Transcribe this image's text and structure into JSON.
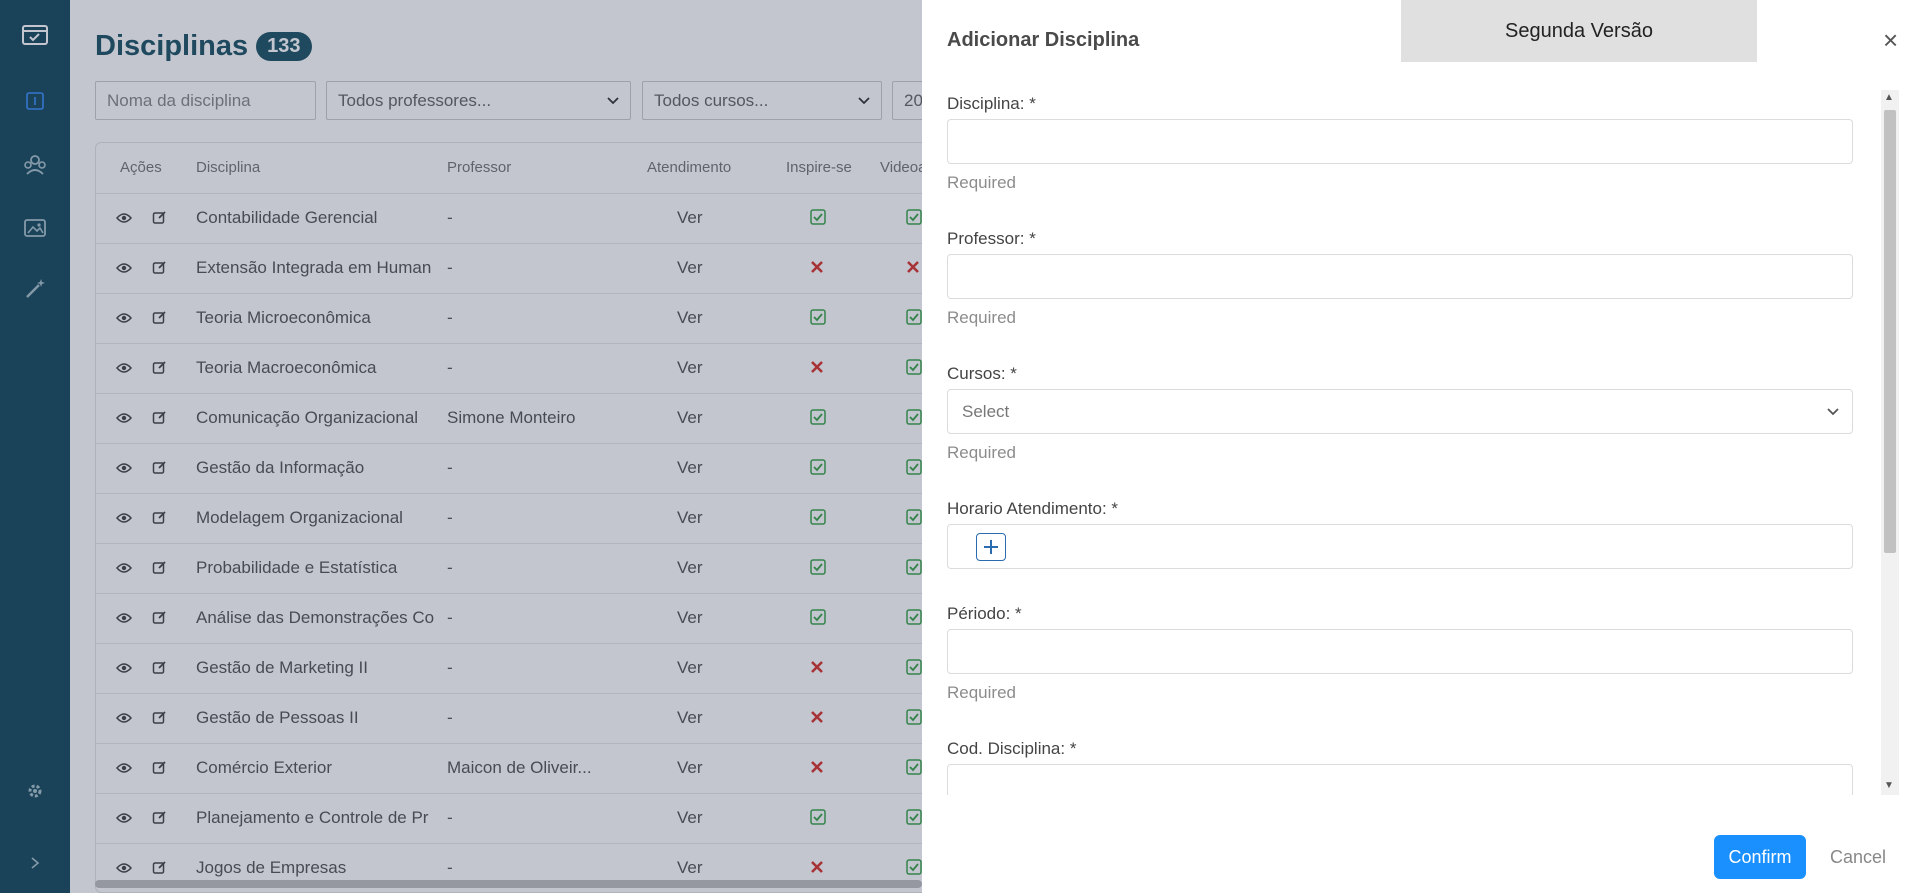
{
  "sidebar": {
    "icons": [
      "dashboard-icon",
      "calendar-icon",
      "users-icon",
      "gallery-icon",
      "magic-wand-icon",
      "settings-icon",
      "expand-icon"
    ]
  },
  "page": {
    "title": "Disciplinas",
    "count": "133"
  },
  "filters": {
    "name_placeholder": "Noma da disciplina",
    "professor": "Todos professores...",
    "cursos": "Todos cursos...",
    "year_partial": "20"
  },
  "table": {
    "headers": [
      "Ações",
      "Disciplina",
      "Professor",
      "Atendimento",
      "Inspire-se",
      "Videoa"
    ],
    "rows": [
      {
        "disciplina": "Contabilidade Gerencial",
        "professor": "-",
        "atendimento": "Ver",
        "inspire": "check",
        "video": "check"
      },
      {
        "disciplina": "Extensão Integrada em Human",
        "professor": "-",
        "atendimento": "Ver",
        "inspire": "cross",
        "video": "cross"
      },
      {
        "disciplina": "Teoria Microeconômica",
        "professor": "-",
        "atendimento": "Ver",
        "inspire": "check",
        "video": "check"
      },
      {
        "disciplina": "Teoria Macroeconômica",
        "professor": "-",
        "atendimento": "Ver",
        "inspire": "cross",
        "video": "check"
      },
      {
        "disciplina": "Comunicação Organizacional",
        "professor": "Simone Monteiro",
        "atendimento": "Ver",
        "inspire": "check",
        "video": "check"
      },
      {
        "disciplina": "Gestão da Informação",
        "professor": "-",
        "atendimento": "Ver",
        "inspire": "check",
        "video": "check"
      },
      {
        "disciplina": "Modelagem Organizacional",
        "professor": "-",
        "atendimento": "Ver",
        "inspire": "check",
        "video": "check"
      },
      {
        "disciplina": "Probabilidade e Estatística",
        "professor": "-",
        "atendimento": "Ver",
        "inspire": "check",
        "video": "check"
      },
      {
        "disciplina": "Análise das Demonstrações Co",
        "professor": "-",
        "atendimento": "Ver",
        "inspire": "check",
        "video": "check"
      },
      {
        "disciplina": "Gestão de Marketing II",
        "professor": "-",
        "atendimento": "Ver",
        "inspire": "cross",
        "video": "check"
      },
      {
        "disciplina": "Gestão de Pessoas II",
        "professor": "-",
        "atendimento": "Ver",
        "inspire": "cross",
        "video": "check"
      },
      {
        "disciplina": "Comércio Exterior",
        "professor": "Maicon de Oliveir...",
        "atendimento": "Ver",
        "inspire": "cross",
        "video": "check"
      },
      {
        "disciplina": "Planejamento e Controle de Pr",
        "professor": "-",
        "atendimento": "Ver",
        "inspire": "check",
        "video": "check"
      },
      {
        "disciplina": "Jogos de Empresas",
        "professor": "-",
        "atendimento": "Ver",
        "inspire": "cross",
        "video": "check"
      }
    ]
  },
  "drawer": {
    "title": "Adicionar Disciplina",
    "version_tab": "Segunda Versão",
    "close_label": "×",
    "fields": {
      "disciplina_label": "Disciplina: *",
      "disciplina_hint": "Required",
      "professor_label": "Professor: *",
      "professor_hint": "Required",
      "cursos_label": "Cursos: *",
      "cursos_placeholder": "Select",
      "cursos_hint": "Required",
      "horario_label": "Horario Atendimento: *",
      "periodo_label": "Périodo: *",
      "periodo_hint": "Required",
      "cod_label": "Cod. Disciplina: *"
    },
    "confirm_label": "Confirm",
    "cancel_label": "Cancel"
  },
  "colors": {
    "sidebar": "#164a5e",
    "primary": "#1a90ff",
    "check": "#39a34a",
    "cross": "#d8322e"
  }
}
